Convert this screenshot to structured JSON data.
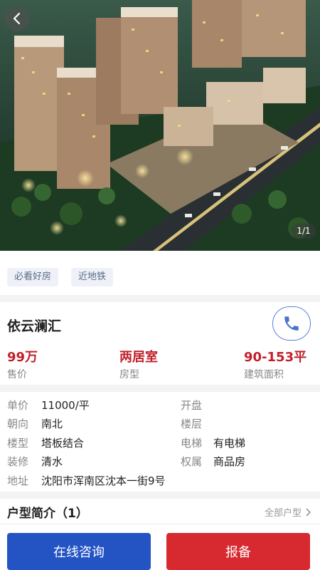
{
  "hero": {
    "counter": "1/1"
  },
  "icons": {
    "back": "back-arrow-icon",
    "phone": "phone-icon",
    "chevron": "chevron-right-icon"
  },
  "tags": [
    "必看好房",
    "近地铁"
  ],
  "property": {
    "name": "依云澜汇"
  },
  "stats": [
    {
      "value": "99万",
      "label": "售价"
    },
    {
      "value": "两居室",
      "label": "房型"
    },
    {
      "value": "90-153平",
      "label": "建筑面积"
    }
  ],
  "details": {
    "unit_price": {
      "key": "单价",
      "value": "11000/平"
    },
    "opening": {
      "key": "开盘",
      "value": ""
    },
    "orientation": {
      "key": "朝向",
      "value": "南北"
    },
    "floor": {
      "key": "楼层",
      "value": ""
    },
    "building_type": {
      "key": "楼型",
      "value": "塔板结合"
    },
    "elevator": {
      "key": "电梯",
      "value": "有电梯"
    },
    "decoration": {
      "key": "装修",
      "value": "清水"
    },
    "ownership": {
      "key": "权属",
      "value": "商品房"
    },
    "address": {
      "key": "地址",
      "value": "沈阳市浑南区沈本一街9号"
    }
  },
  "floor_plans": {
    "title": "户型简介（1）",
    "all_label": "全部户型"
  },
  "actions": {
    "consult": "在线咨询",
    "report": "报备"
  },
  "colors": {
    "accent_blue": "#2453c4",
    "accent_red": "#d62a30",
    "price_red": "#c0202a"
  }
}
